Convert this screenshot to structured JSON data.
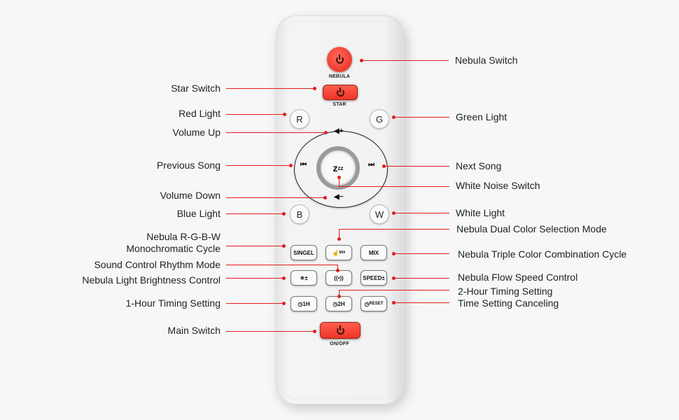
{
  "colors": {
    "accent": "#e31c1c",
    "button_red": "#ef3b2e",
    "background": "#f7f7f7"
  },
  "remote": {
    "nebula_button": {
      "icon": "power-icon",
      "label": "NEBULA"
    },
    "star_button": {
      "icon": "power-icon",
      "label": "STAR"
    },
    "color_buttons": {
      "red": "R",
      "green": "G",
      "blue": "B",
      "white": "W"
    },
    "ring": {
      "volume_up": "◀+",
      "volume_down": "◀−",
      "prev": "⏮",
      "next": "⏭",
      "center": "z",
      "center_sup": "zz"
    },
    "mode_buttons": {
      "single": "SINGEL",
      "dual_mix": "MIX",
      "triple_mix": "MIX",
      "brightness": "☀±",
      "sound": "🎙",
      "speed": "SPEED±",
      "one_hour": "1H",
      "two_hour": "2H",
      "reset": "RESET"
    },
    "onoff_button": {
      "icon": "power-icon",
      "label": "ON/OFF"
    }
  },
  "labels_left": [
    "Star Switch",
    "Red Light",
    "Volume Up",
    "Previous Song",
    "Volume Down",
    "Blue Light",
    "Nebula R-G-B-W",
    "Monochromatic Cycle",
    "Sound Control Rhythm Mode",
    "Nebula Light Brightness Control",
    "1-Hour Timing Setting",
    "Main Switch"
  ],
  "labels_right": [
    "Nebula Switch",
    "Green Light",
    "Next Song",
    "White Noise Switch",
    "White Light",
    "Nebula Dual Color Selection Mode",
    "Nebula Triple Color  Combination Cycle",
    "Nebula Flow Speed Control",
    "2-Hour Timing Setting",
    "Time Setting Canceling"
  ]
}
